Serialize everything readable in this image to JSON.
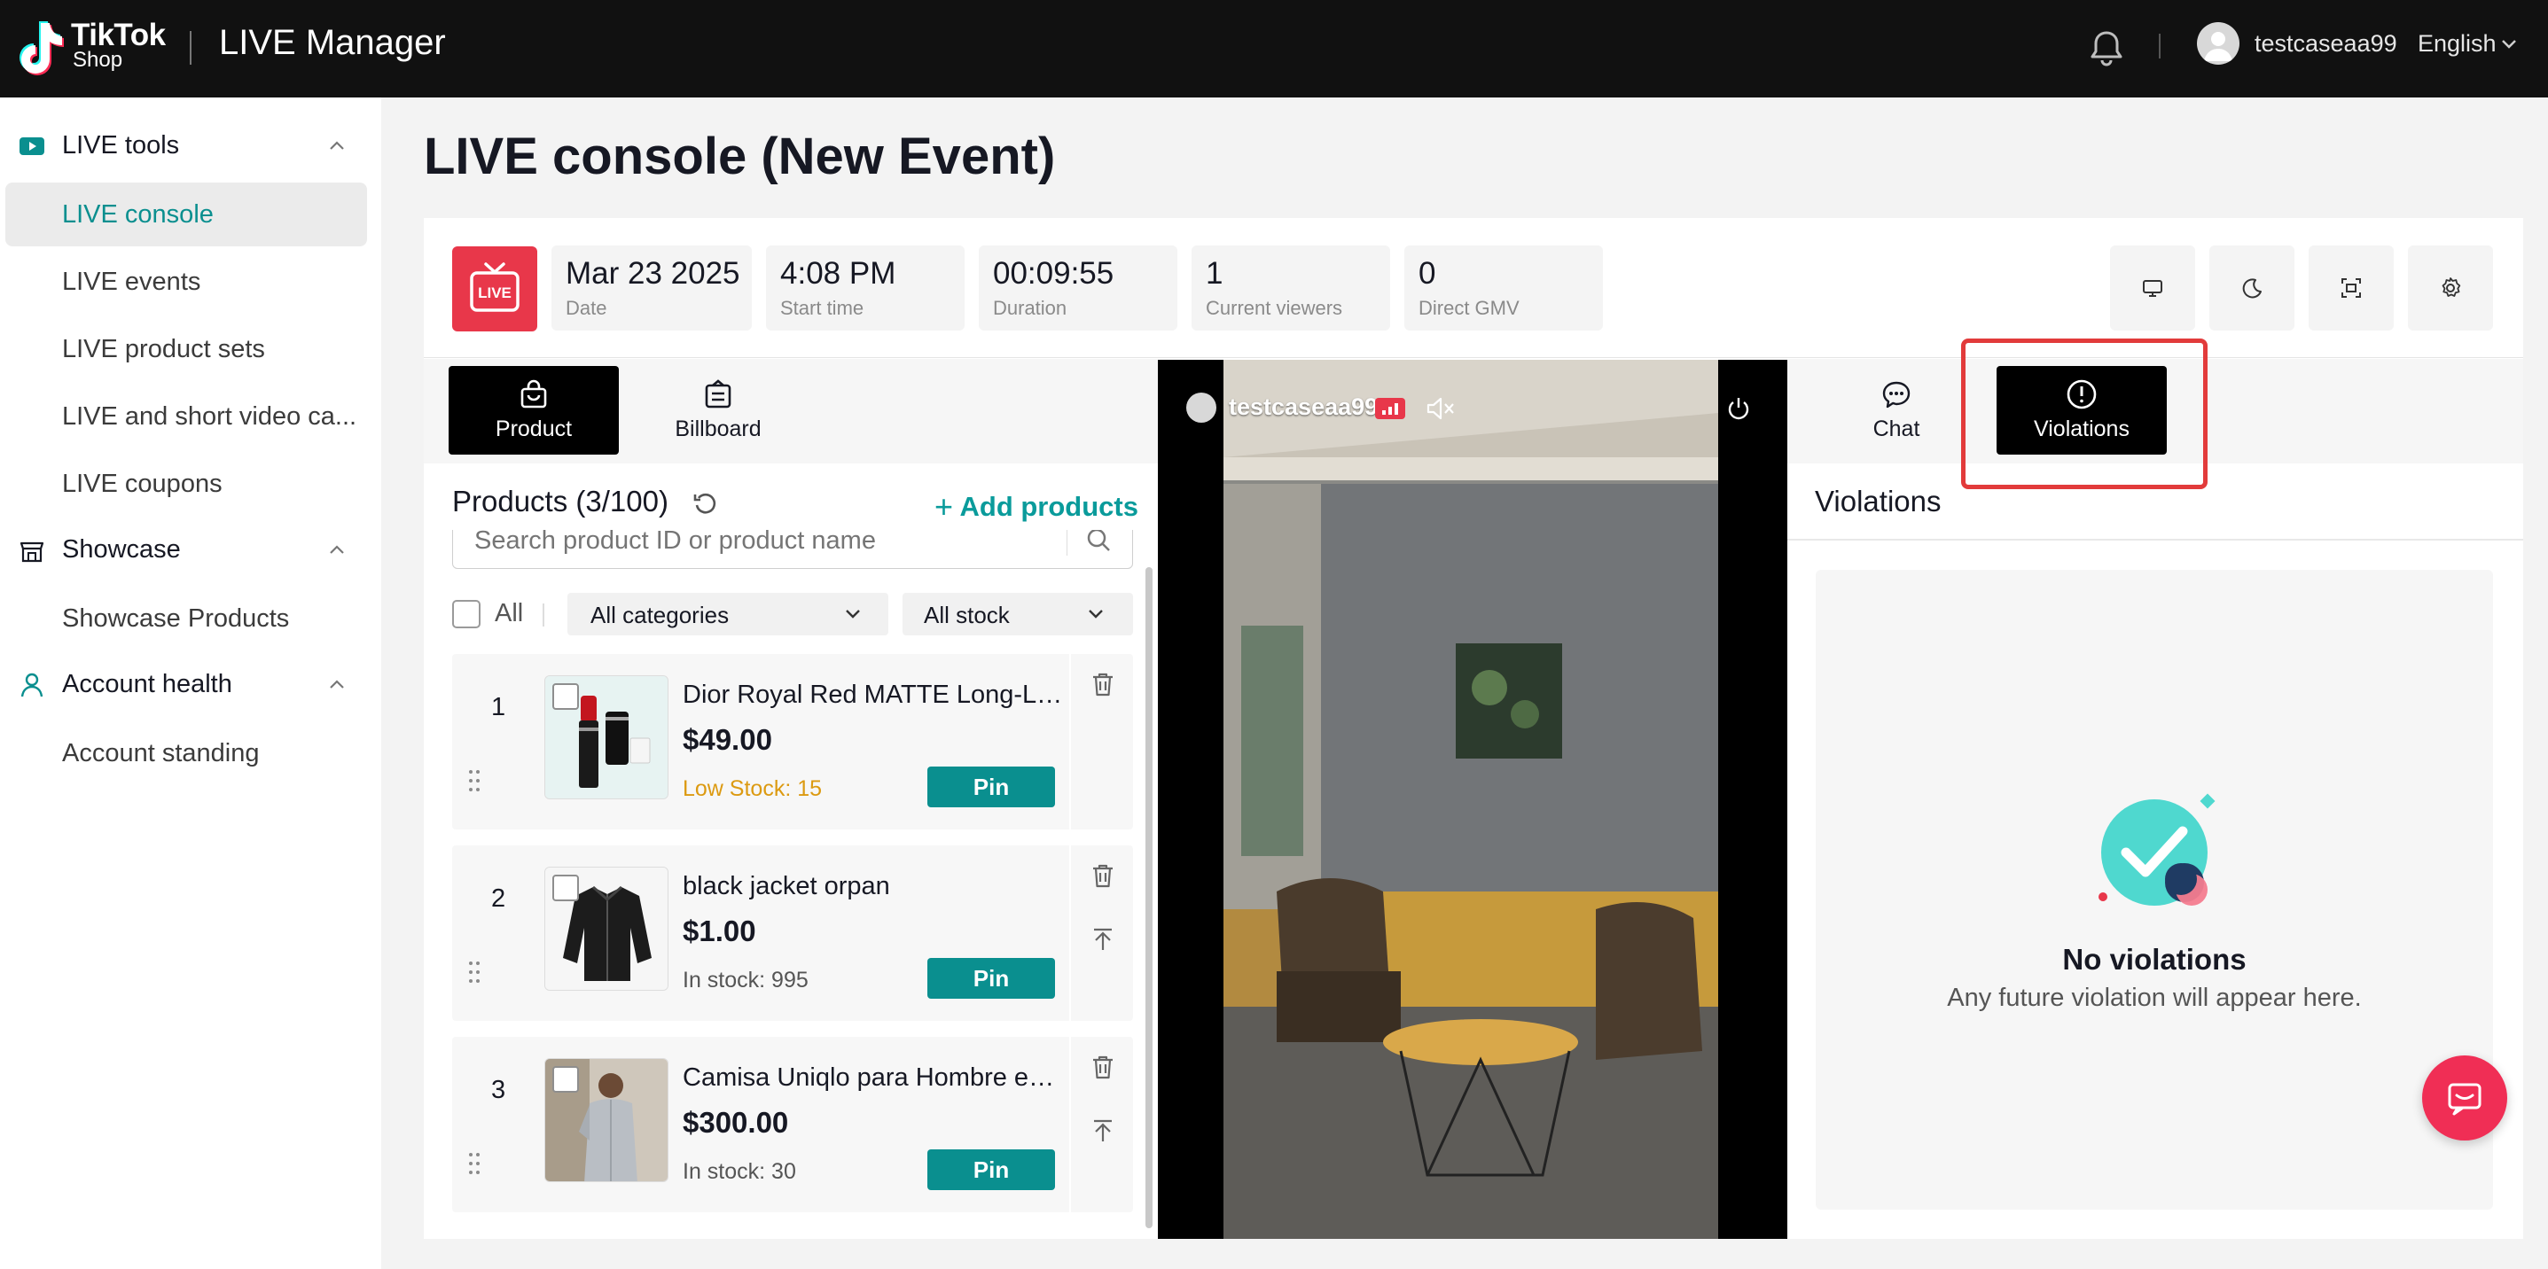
{
  "header": {
    "brand_line1": "TikTok",
    "brand_line2": "Shop",
    "app_title": "LIVE Manager",
    "username": "testcaseaa99",
    "language": "English"
  },
  "sidebar": {
    "groups": [
      {
        "label": "LIVE tools",
        "icon": "live-video-icon",
        "items": [
          "LIVE console",
          "LIVE events",
          "LIVE product sets",
          "LIVE and short video ca...",
          "LIVE coupons"
        ]
      },
      {
        "label": "Showcase",
        "icon": "store-icon",
        "items": [
          "Showcase Products"
        ]
      },
      {
        "label": "Account health",
        "icon": "person-icon",
        "items": [
          "Account standing"
        ]
      }
    ],
    "active_item": "LIVE console"
  },
  "page": {
    "title": "LIVE console (New Event)"
  },
  "stats": [
    {
      "value": "Mar 23 2025",
      "label": "Date"
    },
    {
      "value": "4:08 PM",
      "label": "Start time"
    },
    {
      "value": "00:09:55",
      "label": "Duration"
    },
    {
      "value": "1",
      "label": "Current viewers"
    },
    {
      "value": "0",
      "label": "Direct GMV"
    }
  ],
  "live_badge": "LIVE",
  "toolbar_icons": [
    "monitor-icon",
    "moon-icon",
    "screenshot-icon",
    "settings-icon"
  ],
  "left_tabs": [
    {
      "label": "Product",
      "icon": "shopping-bag-icon",
      "active": true
    },
    {
      "label": "Billboard",
      "icon": "billboard-icon",
      "active": false
    }
  ],
  "products": {
    "title": "Products (3/100)",
    "add_label": "Add products",
    "search_placeholder": "Search product ID or product name",
    "all_label": "All",
    "category_filter": "All categories",
    "stock_filter": "All stock",
    "items": [
      {
        "index": "1",
        "name": "Dior Royal Red MATTE Long-La...",
        "price": "$49.00",
        "stock": "Low Stock: 15",
        "low": true,
        "pin": "Pin"
      },
      {
        "index": "2",
        "name": "black jacket orpan",
        "price": "$1.00",
        "stock": "In stock: 995",
        "low": false,
        "pin": "Pin"
      },
      {
        "index": "3",
        "name": "Camisa Uniqlo para Hombre en...",
        "price": "$300.00",
        "stock": "In stock: 30",
        "low": false,
        "pin": "Pin"
      }
    ]
  },
  "video": {
    "username": "testcaseaa99"
  },
  "right_tabs": [
    {
      "label": "Chat",
      "icon": "chat-icon",
      "active": false
    },
    {
      "label": "Violations",
      "icon": "alert-circle-icon",
      "active": true
    }
  ],
  "violations": {
    "title": "Violations",
    "empty_title": "No violations",
    "empty_subtitle": "Any future violation will appear here."
  },
  "colors": {
    "accent": "#0a8f8f",
    "live_red": "#e8374a",
    "highlight": "#e23b3b",
    "low_stock": "#dc9a11"
  }
}
